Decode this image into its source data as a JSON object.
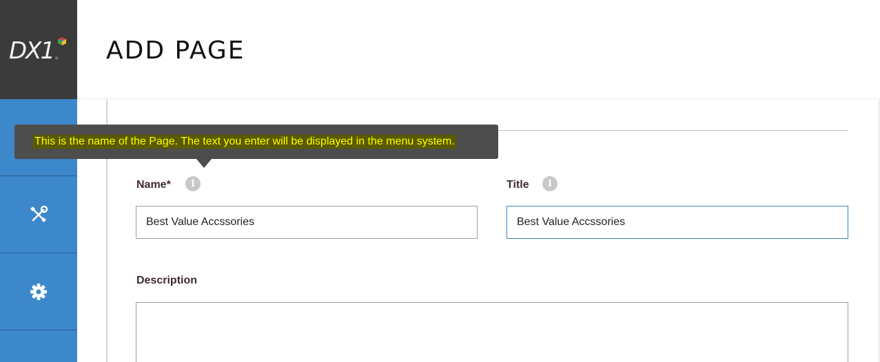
{
  "brand": {
    "logo_text": "DX1",
    "logo_mark": "®"
  },
  "header": {
    "title": "ADD PAGE"
  },
  "sidebar": {
    "items": [
      {
        "icon": "blank-icon"
      },
      {
        "icon": "wrench-screwdriver-icon"
      },
      {
        "icon": "gear-icon"
      }
    ]
  },
  "form": {
    "name_label": "Name*",
    "name_value": "Best Value Accssories",
    "title_label": "Title",
    "title_value": "Best Value Accssories",
    "description_label": "Description",
    "description_value": ""
  },
  "tooltip": {
    "text": "This is the name of the Page. The text you enter will be displayed in the menu system."
  },
  "colors": {
    "sidebar": "#3d87cb",
    "logo_bg": "#3b3b3b",
    "focus_border": "#3a86c2",
    "tooltip_bg": "#4d4d4d",
    "tooltip_text": "#ffff00"
  }
}
